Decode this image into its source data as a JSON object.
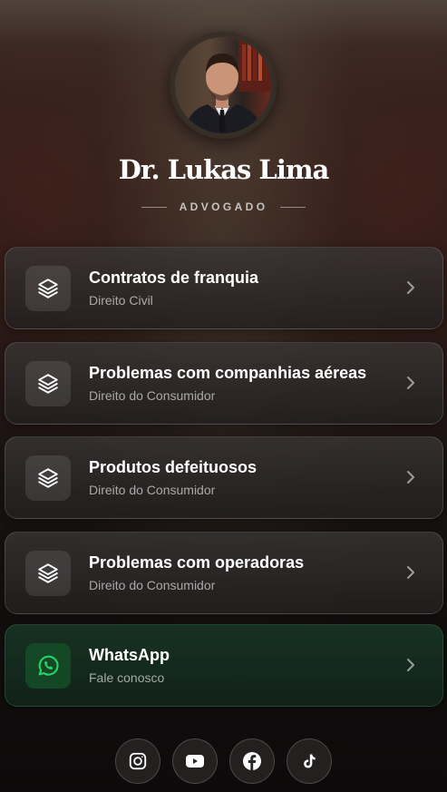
{
  "profile": {
    "name": "Dr. Lukas Lima",
    "role": "ADVOGADO"
  },
  "links": [
    {
      "title": "Contratos de franquia",
      "subtitle": "Direito Civil",
      "icon": "layers-icon"
    },
    {
      "title": "Problemas com companhias aéreas",
      "subtitle": "Direito do Consumidor",
      "icon": "layers-icon"
    },
    {
      "title": "Produtos defeituosos",
      "subtitle": "Direito do Consumidor",
      "icon": "layers-icon"
    },
    {
      "title": "Problemas com operadoras",
      "subtitle": "Direito do Consumidor",
      "icon": "layers-icon"
    }
  ],
  "whatsapp": {
    "title": "WhatsApp",
    "subtitle": "Fale conosco",
    "icon": "whatsapp-icon",
    "color": "#25D366"
  },
  "socials": [
    "instagram-icon",
    "youtube-icon",
    "facebook-icon",
    "tiktok-icon"
  ]
}
